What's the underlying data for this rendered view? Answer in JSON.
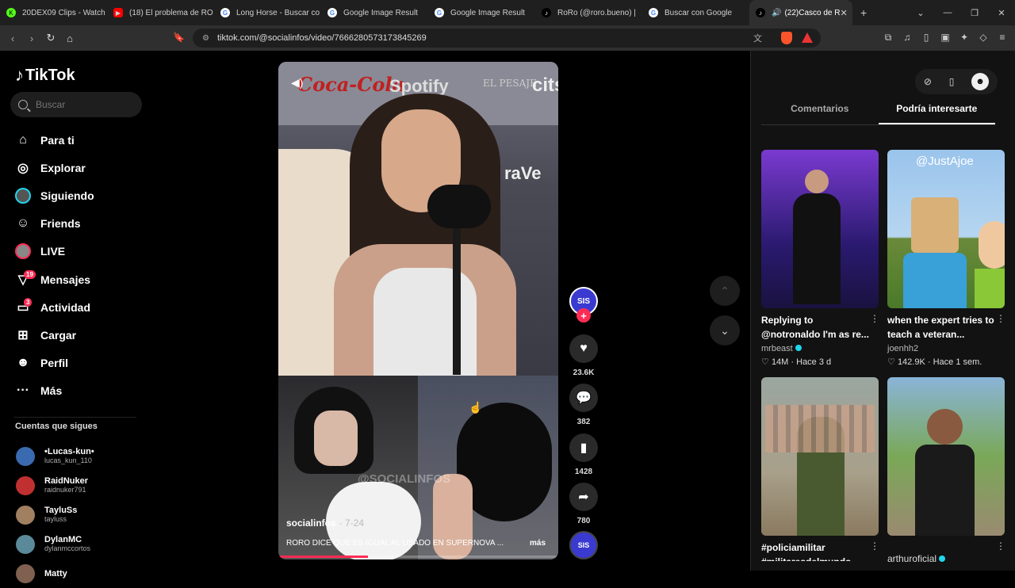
{
  "browser": {
    "tabs": [
      {
        "label": "20DEX09 Clips - Watch",
        "fav": "K",
        "color": "#53fc18"
      },
      {
        "label": "(18) El problema de RO",
        "fav": "▶",
        "color": "#ff0000"
      },
      {
        "label": "Long Horse - Buscar co",
        "fav": "G",
        "color": "#4285f4"
      },
      {
        "label": "Google Image Result",
        "fav": "G",
        "color": "#4285f4"
      },
      {
        "label": "Google Image Result",
        "fav": "G",
        "color": "#4285f4"
      },
      {
        "label": "RoRo (@roro.bueno) |",
        "fav": "♪",
        "color": "#000000"
      },
      {
        "label": "Buscar con Google",
        "fav": "G",
        "color": "#4285f4"
      }
    ],
    "active_tab": "(22)Casco de R",
    "url": "tiktok.com/@socialinfos/video/7666280573173845269"
  },
  "sidebar": {
    "logo": "TikTok",
    "search_placeholder": "Buscar",
    "nav": [
      {
        "label": "Para ti",
        "icon": "⌂"
      },
      {
        "label": "Explorar",
        "icon": "◎"
      },
      {
        "label": "Siguiendo",
        "icon": ""
      },
      {
        "label": "Friends",
        "icon": "☺"
      },
      {
        "label": "LIVE",
        "icon": ""
      },
      {
        "label": "Mensajes",
        "icon": "▽",
        "badge": "19"
      },
      {
        "label": "Actividad",
        "icon": "▭",
        "badge": "3"
      },
      {
        "label": "Cargar",
        "icon": "⊞"
      },
      {
        "label": "Perfil",
        "icon": "☻"
      },
      {
        "label": "Más",
        "icon": "···"
      }
    ],
    "following_title": "Cuentas que sigues",
    "following": [
      {
        "name": "•Lucas-kun•",
        "user": "lucas_kun_110",
        "color": "#3a6ab0"
      },
      {
        "name": "RaidNuker",
        "user": "raidnuker791",
        "color": "#c03030"
      },
      {
        "name": "TayluSs",
        "user": "tayluss",
        "color": "#a08060"
      },
      {
        "name": "DylanMC",
        "user": "dylanmccortos",
        "color": "#5a8a9a"
      },
      {
        "name": "Matty",
        "user": "",
        "color": "#806050"
      }
    ]
  },
  "video": {
    "brand_coca": "Coca-Cola",
    "brand_spotify": "Spotify",
    "brand_ep": "EL PESAJE",
    "brand_ci": "cits",
    "brand_ve": "raVe",
    "watermark": "@SOCIALINFOS",
    "author": "socialinfos",
    "date": "· 7-24",
    "caption": "RORO DICE QUE ES IGUAL AL USADO EN SUPERNOVA ...",
    "more": "más",
    "progress": 0.32
  },
  "actions": {
    "creator_initials": "SIS",
    "likes": "23.6K",
    "comments": "382",
    "saves": "1428",
    "shares": "780"
  },
  "right_panel": {
    "tabs": [
      "Comentarios",
      "Podría interesarte"
    ],
    "active_tab": "Podría interesarte",
    "videos": [
      {
        "title": "Replying to @notronaldo I'm as re...",
        "user": "mrbeast",
        "verified": true,
        "views": "14M",
        "date": "Hace 3 d",
        "overlay": ""
      },
      {
        "title": "when the expert tries to teach a veteran...",
        "user": "joenhh2",
        "verified": false,
        "views": "142.9K",
        "date": "Hace 1 sem.",
        "overlay": "@JustAjoe"
      },
      {
        "title": "#policiamilitar #militaresdelmundo",
        "user": "",
        "verified": false,
        "views": "",
        "date": "",
        "overlay": ""
      },
      {
        "title": "",
        "user": "arthuroficial",
        "verified": true,
        "views": "",
        "date": "",
        "overlay": ""
      }
    ]
  }
}
